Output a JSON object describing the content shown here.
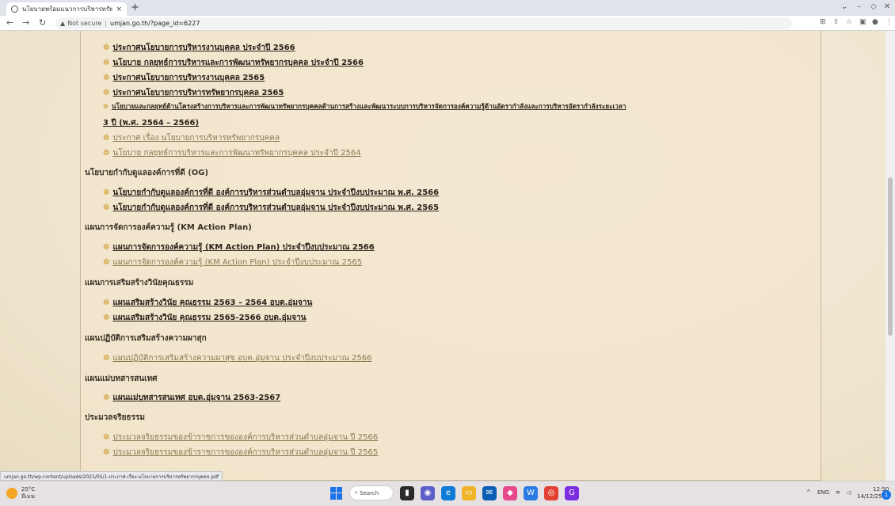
{
  "browser": {
    "tab_title": "นโยบายพร้อมแนวการบริหารทรัพยากรบุ",
    "tab_close": "×",
    "new_tab": "+",
    "not_secure": "Not secure",
    "url": "umjan.go.th/?page_id=6227",
    "status_url": "umjan.go.th/wp-content/uploads/2021/05/1-ประกาศ-เรื่อง-นโยบายการบริหารทรัพยากรบุคคล.pdf"
  },
  "content": {
    "section1": [
      {
        "text": "ประกาศนโยบายการบริหารงานบุคคล ประจำปี 2566",
        "visited": false
      },
      {
        "text": "นโยบาย กลยุทธ์การบริหารและการพัฒนาทรัพยากรบุคคล ประจำปี 2566",
        "visited": false
      },
      {
        "text": "ประกาศนโยบายการบริหารงานบุคคล 2565",
        "visited": false
      },
      {
        "text": "ประกาศนโยบายการบริหารทรัพยากรบุคคล 2565",
        "visited": false
      },
      {
        "text": "นโยบายและกลยุทธ์ด้านโครงสร้างการบริหารและการพัฒนาทรัพยากรบุคคลด้านการสร้างและพัฒนาระบบการบริหารจัดการองค์ความรู้ด้านอัตรากำลังและการบริหารอัตรากำลังระยะเวลา",
        "visited": false
      },
      {
        "text": "3 ปี (พ.ศ. 2564 – 2566)",
        "visited": false
      },
      {
        "text": "ประกาศ เรื่อง นโยบายการบริหารทรัพยากรบุคคล",
        "visited": true
      },
      {
        "text": "นโยบาย กลยุทธ์การบริหารและการพัฒนาทรัพยากรบุคคล ประจำปี 2564",
        "visited": true
      }
    ],
    "og_heading": "นโยบายกำกับดูแลองค์การที่ดี (OG)",
    "og_links": [
      "นโยบายกำกับดูแลองค์การที่ดี องค์การบริหารส่วนตำบลอุ่มจาน ประจำปีงบประมาณ พ.ศ. 2566",
      "นโยบายกำกับดูแลองค์การที่ดี องค์การบริหารส่วนตำบลอุ่มจาน ประจำปีงบประมาณ พ.ศ. 2565"
    ],
    "km_heading": "แผนการจัดการองค์ความรู้ (KM Action Plan)",
    "km_links": [
      "แผนการจัดการองค์ความรู้ (KM Action Plan) ประจำปีงบประมาณ 2566",
      "แผนการจัดการองค์ความรู้ (KM Action Plan) ประจำปีงบประมาณ 2565"
    ],
    "ethics_heading": "แผนการเสริมสร้างวินัยคุณธรรม",
    "ethics_links": [
      "แผนเสริมสร้างวินัย คุณธรรม 2563 – 2564 อบต.อุ่มจาน",
      "แผนเสริมสร้างวินัย คุณธรรม 2565-2566 อบต.อุ่มจาน"
    ],
    "happy_heading": "แผนปฏิบัติการเสริมสร้างความผาสุก",
    "happy_links": [
      "แผนปฏิบัติการเสริมสร้างความผาสุข อบต.อุ่มจาน ประจำปีงบประมาณ 2566"
    ],
    "it_heading": "แผนแม่บทสารสนเทศ",
    "it_links": [
      "แผนแม่บทสารสนเทศ อบต.อุ่มจาน 2563-2567"
    ],
    "code_heading": "ประมวลจริยธรรม",
    "code_links": [
      "ประมวลจริยธรรมของข้าราชการขององค์การบริหารส่วนตำบลอุ่มจาน ปี 2566",
      "ประมวลจริยธรรมของข้าราชการขององค์การบริหารส่วนตำบลอุ่มจาน ปี 2565"
    ]
  },
  "taskbar": {
    "temp": "25°C",
    "weather": "มีเมฆ",
    "search": "Search",
    "lang": "ENG",
    "time": "12:50",
    "date": "14/12/2565",
    "notif_count": "1"
  }
}
